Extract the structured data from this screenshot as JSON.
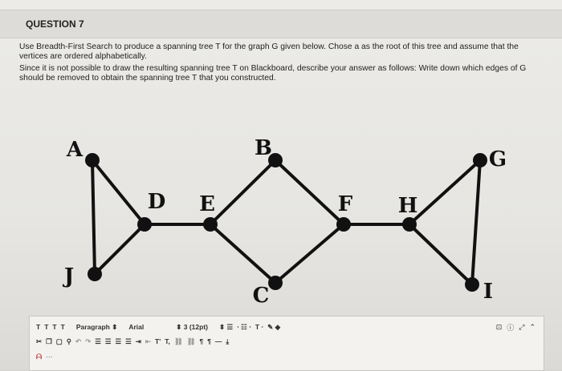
{
  "question": {
    "title": "QUESTION 7",
    "paragraph1": "Use Breadth-First Search to produce a spanning tree T for the graph G given below. Chose a as the root of this tree and assume that the vertices are ordered alphabetically.",
    "paragraph2": "Since it is not possible to draw the resulting spanning tree T on Blackboard, describe your answer as follows: Write down which edges of G should be removed to obtain the spanning tree T that you constructed."
  },
  "graph": {
    "vertices": {
      "A": "A",
      "B": "B",
      "C": "C",
      "D": "D",
      "E": "E",
      "F": "F",
      "G": "G",
      "H": "H",
      "I": "I",
      "J": "J"
    },
    "edges": [
      [
        "A",
        "J"
      ],
      [
        "A",
        "D"
      ],
      [
        "D",
        "J"
      ],
      [
        "D",
        "E"
      ],
      [
        "E",
        "B"
      ],
      [
        "E",
        "C"
      ],
      [
        "B",
        "F"
      ],
      [
        "C",
        "F"
      ],
      [
        "F",
        "H"
      ],
      [
        "H",
        "G"
      ],
      [
        "H",
        "I"
      ],
      [
        "G",
        "I"
      ]
    ],
    "node_color": "#111111",
    "edge_color": "#111111"
  },
  "toolbar": {
    "row1": {
      "text_style_buttons": [
        "T",
        "T",
        "T",
        "T"
      ],
      "paragraph_label": "Paragraph",
      "font_label": "Arial",
      "size_label": "3 (12pt)"
    },
    "row2": {
      "superscript": "T'",
      "subscript": "T,"
    }
  }
}
